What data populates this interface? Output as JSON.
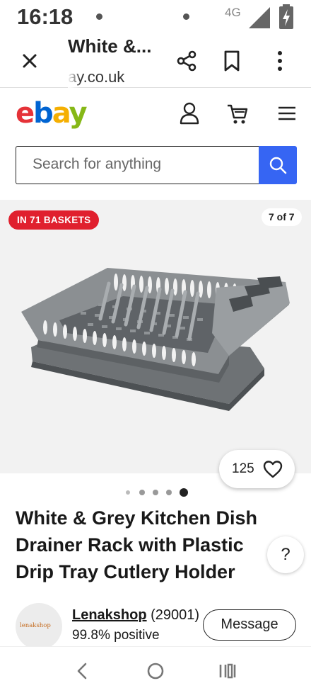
{
  "status_bar": {
    "time": "16:18",
    "network": "4G"
  },
  "browser": {
    "title": "White &...",
    "url": "ay.co.uk"
  },
  "ebay": {
    "logo": {
      "e": "e",
      "b": "b",
      "a": "a",
      "y": "y"
    },
    "logo_colors": [
      "#e53238",
      "#0064d2",
      "#f5af02",
      "#86b817"
    ]
  },
  "search": {
    "placeholder": "Search for anything",
    "button_color": "#3665f3"
  },
  "gallery": {
    "badge": "IN 71 BASKETS",
    "badge_color": "#e0202e",
    "counter": "7 of 7",
    "watch_count": "125",
    "dots_total": 5,
    "dots_active_index": 4
  },
  "item": {
    "title": "White & Grey Kitchen Dish Drainer Rack with Plastic Drip Tray Cutlery Holder"
  },
  "help": {
    "label": "?"
  },
  "seller": {
    "avatar_text": "lenakshop",
    "name": "Lenakshop",
    "feedback_count": " (29001)",
    "positive": "99.8% positive",
    "message_button": "Message"
  }
}
